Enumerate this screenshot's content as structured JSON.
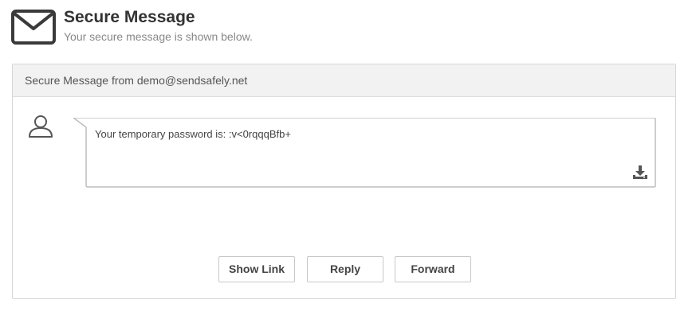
{
  "header": {
    "icon": "envelope-icon",
    "title": "Secure Message",
    "subtitle": "Your secure message is shown below."
  },
  "panel": {
    "heading": "Secure Message from demo@sendsafely.net",
    "avatar_icon": "user-icon",
    "message": "Your temporary password is: :v<0rqqqBfb+",
    "download_icon": "download-icon"
  },
  "actions": {
    "show_link_label": "Show Link",
    "reply_label": "Reply",
    "forward_label": "Forward"
  }
}
